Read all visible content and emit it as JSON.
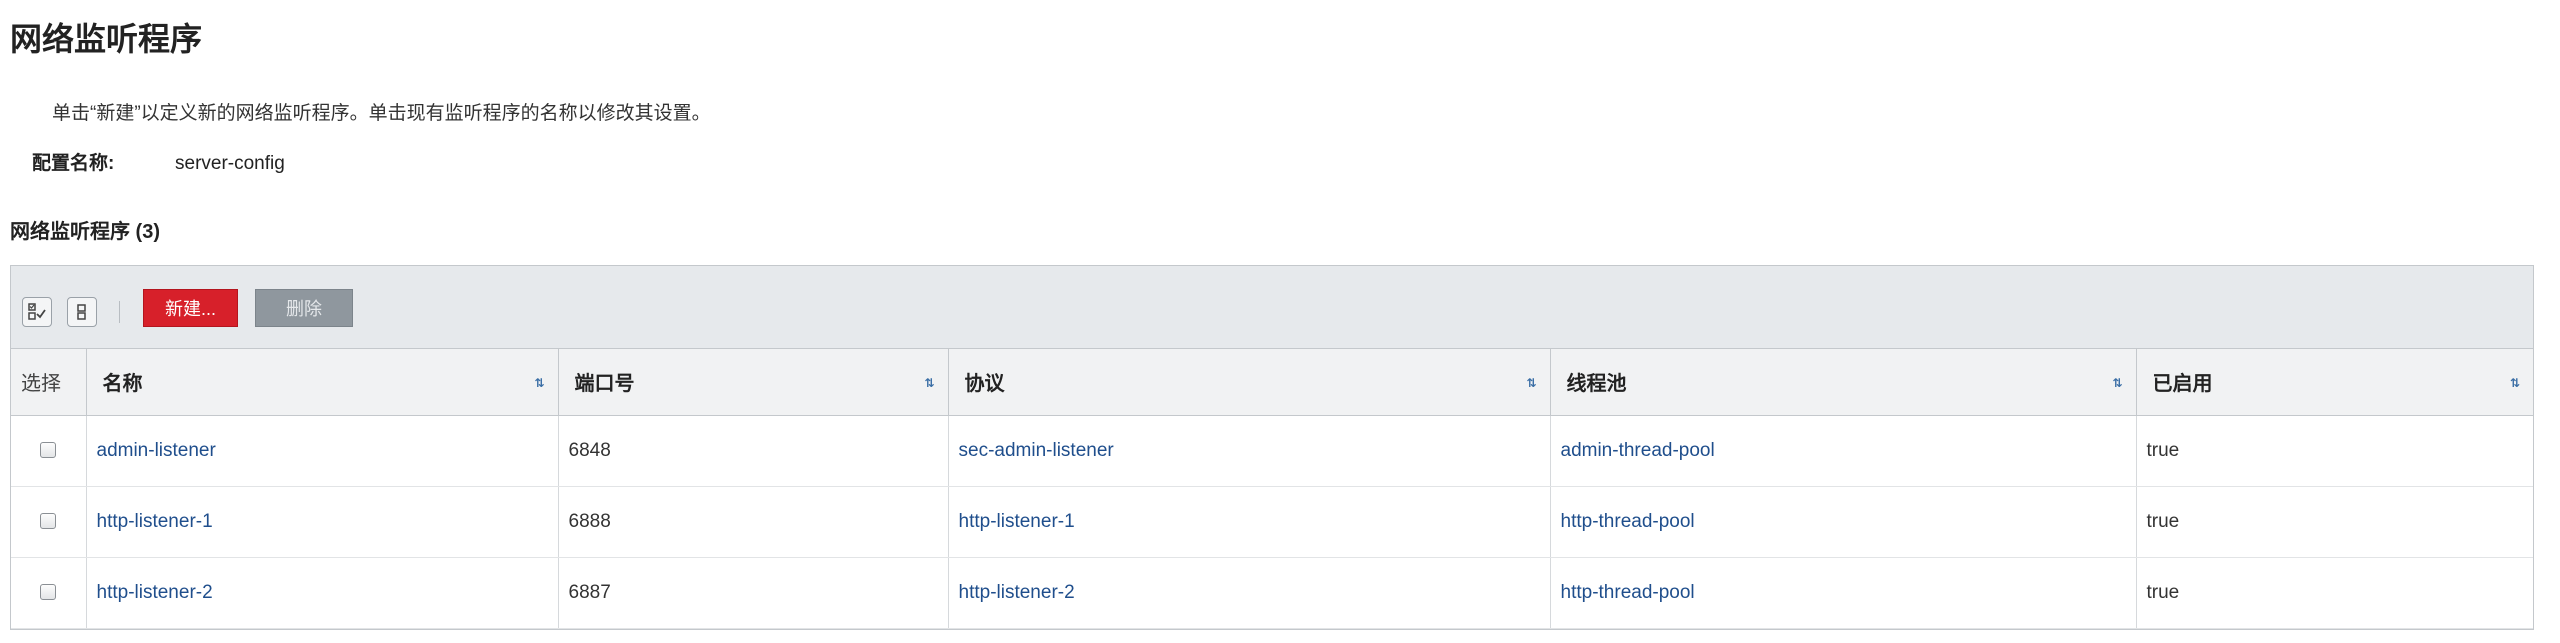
{
  "page": {
    "title": "网络监听程序",
    "help_text": "单击“新建”以定义新的网络监听程序。单击现有监听程序的名称以修改其设置。",
    "config_label": "配置名称:",
    "config_value": "server-config",
    "section_title": "网络监听程序 (3)"
  },
  "toolbar": {
    "select_all_icon": "select-all-icon",
    "deselect_all_icon": "deselect-all-icon",
    "new_label": "新建...",
    "delete_label": "删除"
  },
  "table": {
    "columns": [
      "选择",
      "名称",
      "端口号",
      "协议",
      "线程池",
      "已启用"
    ],
    "rows": [
      {
        "name": "admin-listener",
        "port": "6848",
        "protocol": "sec-admin-listener",
        "thread_pool": "admin-thread-pool",
        "enabled": "true"
      },
      {
        "name": "http-listener-1",
        "port": "6888",
        "protocol": "http-listener-1",
        "thread_pool": "http-thread-pool",
        "enabled": "true"
      },
      {
        "name": "http-listener-2",
        "port": "6887",
        "protocol": "http-listener-2",
        "thread_pool": "http-thread-pool",
        "enabled": "true"
      }
    ]
  },
  "colors": {
    "new_button": "#d7202a",
    "delete_button": "#8f979e",
    "link": "#1f4e8c",
    "toolbar_bg": "#e6e9ec"
  }
}
